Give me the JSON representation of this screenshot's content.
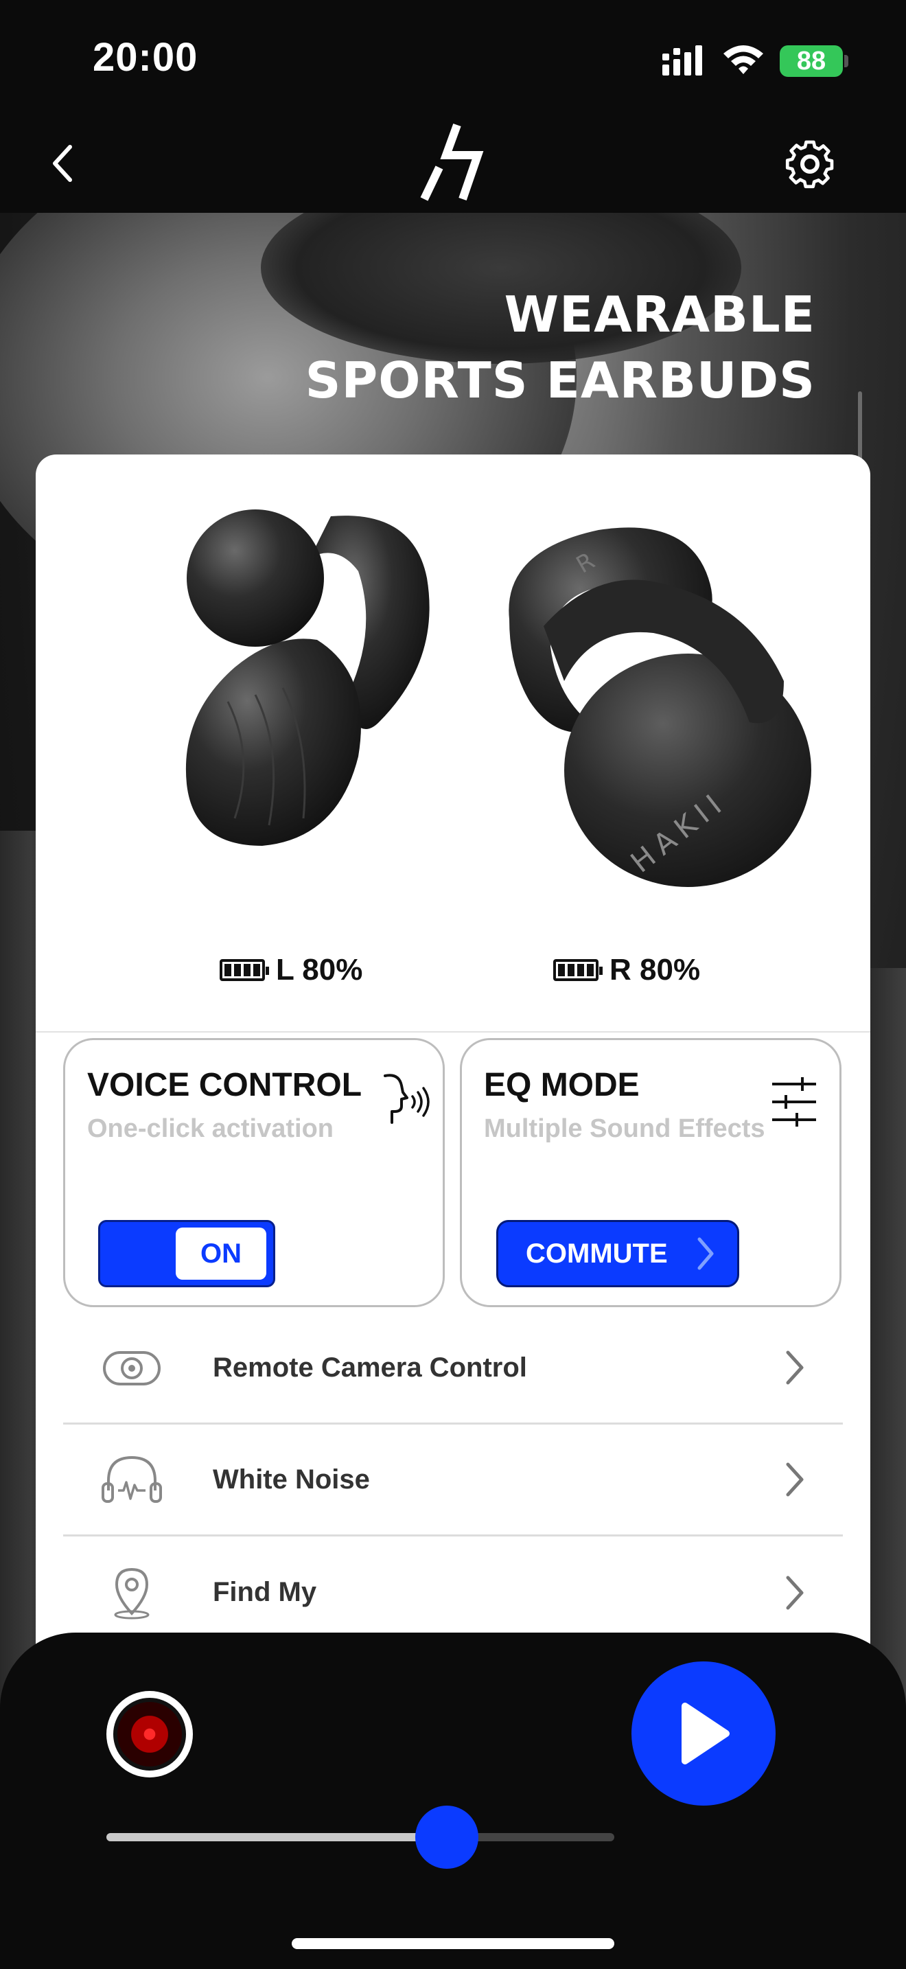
{
  "status_bar": {
    "time": "20:00",
    "battery": "88"
  },
  "hero": {
    "title_line1": "WEARABLE",
    "title_line2": "SPORTS EARBUDS"
  },
  "earbuds": {
    "brand_mark": "HAKII",
    "left_label": "L 80%",
    "right_label": "R 80%"
  },
  "voice_control": {
    "title": "VOICE CONTROL",
    "subtitle": "One-click activation",
    "toggle_label": "ON"
  },
  "eq_mode": {
    "title": "EQ MODE",
    "subtitle": "Multiple Sound Effects",
    "button_label": "COMMUTE"
  },
  "menu": [
    {
      "label": "Remote Camera Control",
      "icon": "camera-icon"
    },
    {
      "label": "White Noise",
      "icon": "headphones-icon"
    },
    {
      "label": "Find My",
      "icon": "location-pin-icon"
    }
  ],
  "player": {
    "volume": 0.67
  },
  "colors": {
    "accent": "#0b3bff",
    "battery": "#34c759",
    "subtitle": "#c6c6c6"
  }
}
